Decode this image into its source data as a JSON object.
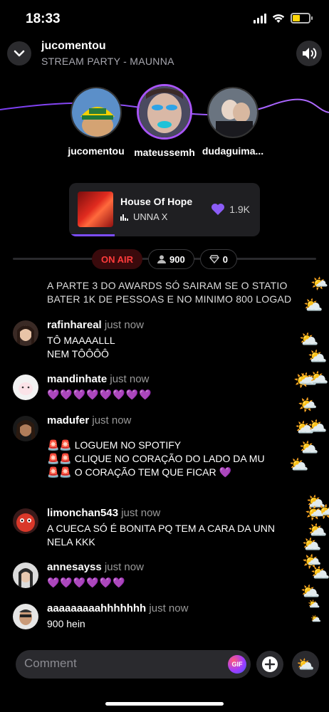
{
  "status": {
    "time": "18:33"
  },
  "header": {
    "host": "jucomentou",
    "subtitle": "STREAM PARTY - MAUNNA"
  },
  "participants": [
    {
      "name": "jucomentou",
      "active": false
    },
    {
      "name": "mateussemh",
      "active": true
    },
    {
      "name": "dudaguima...",
      "active": false
    }
  ],
  "now_playing": {
    "title": "House Of Hope",
    "artist": "UNNA X",
    "likes": "1.9K",
    "progress": 0.24
  },
  "live": {
    "on_air": "ON AIR",
    "listeners": "900",
    "gems": "0"
  },
  "chat": {
    "system": "A PARTE 3 DO AWARDS SÓ SAIRAM SE O STATIO\nBATER 1K DE PESSOAS E NO MINIMO 800 LOGAD",
    "messages": [
      {
        "user": "rafinhareal",
        "time": "just now",
        "text": "TÔ MAAAALLL\nNEM TÔÔÔÔ"
      },
      {
        "user": "mandinhate",
        "time": "just now",
        "text": "💜💜💜💜💜💜💜💜"
      },
      {
        "user": "madufer",
        "time": "just now",
        "text": "🚨🚨 LOGUEM NO SPOTIFY\n🚨🚨 CLIQUE NO CORAÇÃO DO LADO DA MU\n🚨🚨 O CORAÇÃO TEM QUE FICAR 💜"
      },
      {
        "user": "limonchan543",
        "time": "just now",
        "text": "A CUECA SÓ É BONITA PQ TEM A CARA DA UNN\nNELA KKK"
      },
      {
        "user": "annesayss",
        "time": "just now",
        "text": "💜💜💜💜💜💜"
      },
      {
        "user": "aaaaaaaaahhhhhhh",
        "time": "just now",
        "text": "900 hein"
      }
    ]
  },
  "composer": {
    "placeholder": "Comment",
    "gif_label": "GIF"
  },
  "colors": {
    "accent": "#a855f7",
    "on_air": "#ff3b3b",
    "heart": "#9b4dff"
  },
  "icons": [
    "chevron-down-icon",
    "speaker-icon",
    "heart-icon",
    "person-icon",
    "gem-icon",
    "plus-icon",
    "weather-icon"
  ]
}
